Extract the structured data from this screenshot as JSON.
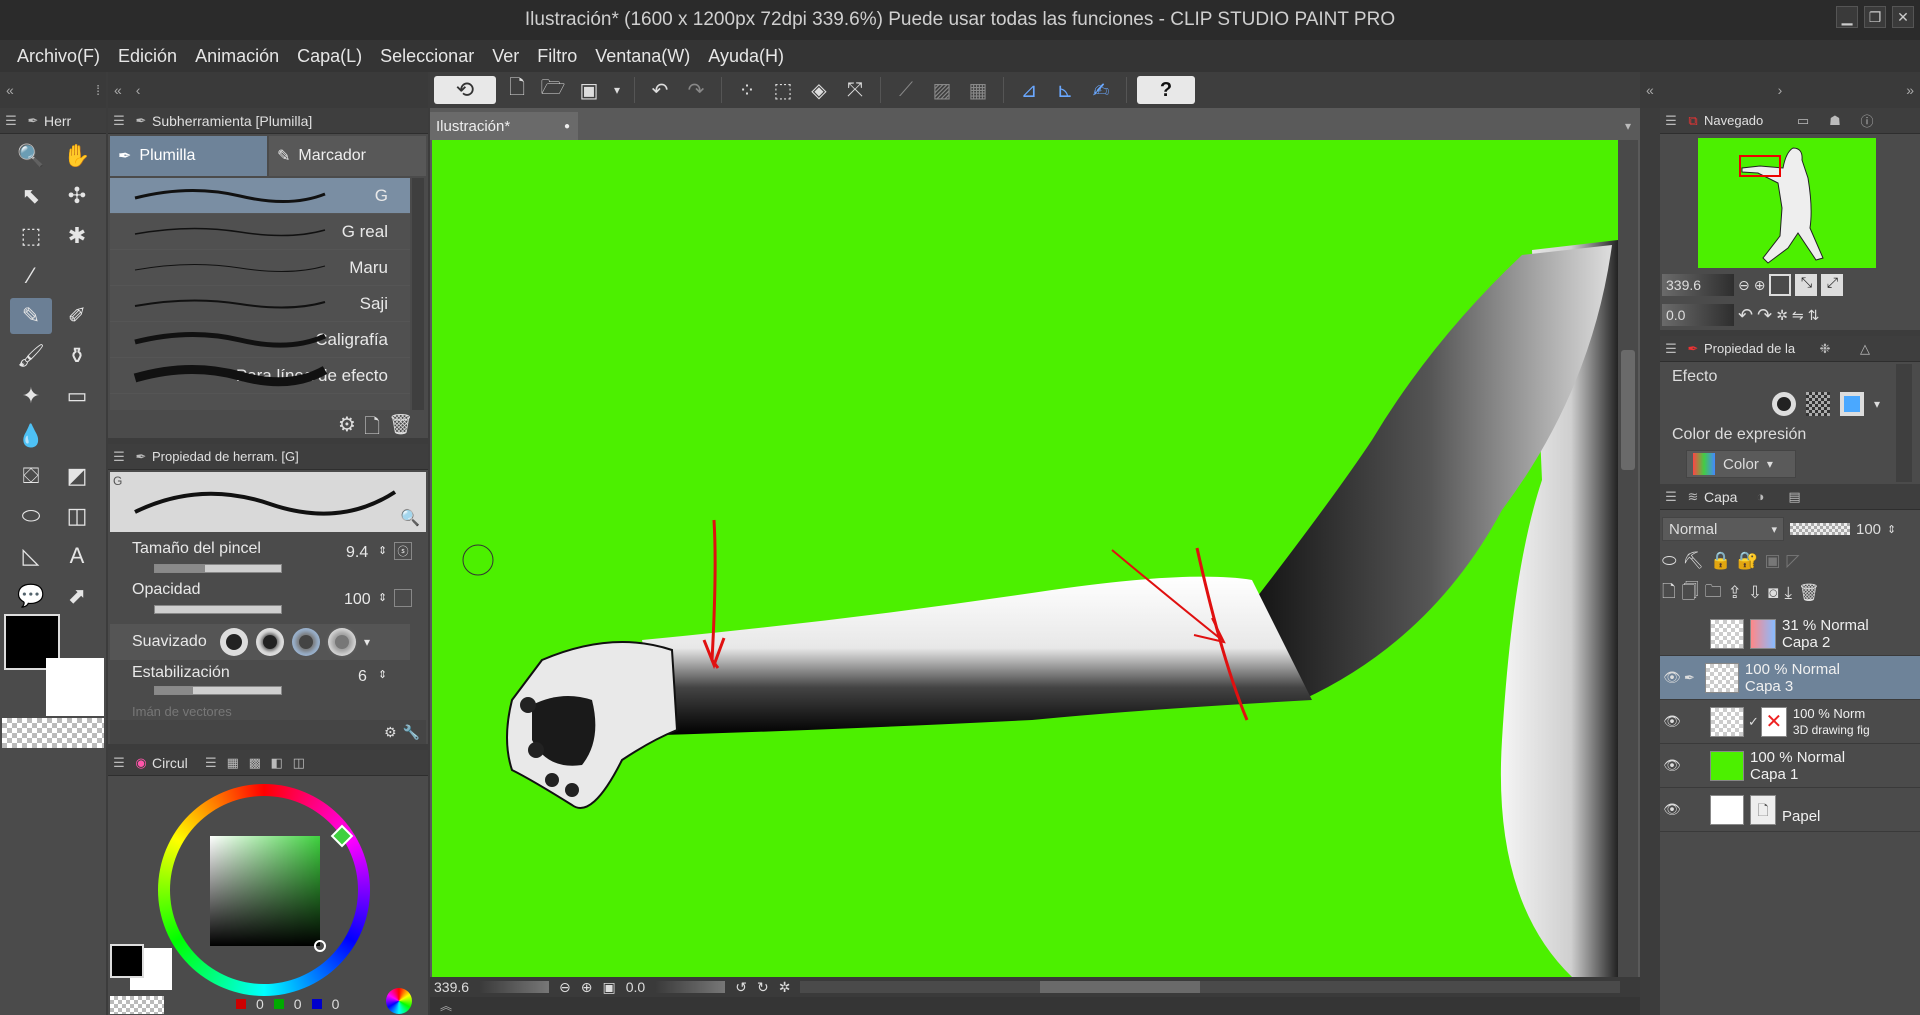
{
  "window": {
    "title": "Ilustración* (1600 x 1200px 72dpi 339.6%)  Puede usar todas las funciones - CLIP STUDIO PAINT PRO",
    "controls": [
      "minimize-icon",
      "maximize-icon",
      "close-icon"
    ]
  },
  "menu": [
    "Archivo(F)",
    "Edición",
    "Animación",
    "Capa(L)",
    "Seleccionar",
    "Ver",
    "Filtro",
    "Ventana(W)",
    "Ayuda(H)"
  ],
  "tool_panel": {
    "title": "Herr"
  },
  "subtool": {
    "title": "Subherramienta [Plumilla]",
    "tabs": [
      "Plumilla",
      "Marcador"
    ],
    "brushes": [
      "G",
      "G real",
      "Maru",
      "Saji",
      "Caligrafía",
      "Para línea de efecto"
    ]
  },
  "tool_property": {
    "title": "Propiedad de herram. [G]",
    "preview_label": "G",
    "brush_size_label": "Tamaño del pincel",
    "brush_size_value": "9.4",
    "opacity_label": "Opacidad",
    "opacity_value": "100",
    "smoothing_label": "Suavizado",
    "stabilization_label": "Estabilización",
    "stabilization_value": "6",
    "hidden_row": "Imán de vectores"
  },
  "color_panel": {
    "title": "Circul",
    "rgb": [
      "0",
      "0",
      "0"
    ],
    "main_color": "#000000",
    "sub_color": "#ffffff",
    "square_hue_color": "#3fd13f"
  },
  "document": {
    "tab_label": "Ilustración*",
    "zoom": "339.6",
    "rotation": "0.0",
    "background_color": "#4cf000"
  },
  "navigator": {
    "title": "Navegado",
    "zoom": "339.6",
    "rotation": "0.0"
  },
  "tool_prop2": {
    "title": "Propiedad de la",
    "effect_label": "Efecto",
    "expression_color_label": "Color de expresión",
    "expression_color_value": "Color"
  },
  "layers": {
    "title": "Capa",
    "blend_mode": "Normal",
    "opacity": "100",
    "rows": [
      {
        "opacity": "31 % Normal",
        "name": "Capa 2",
        "visible": false,
        "selected": false
      },
      {
        "opacity": "100 % Normal",
        "name": "Capa 3",
        "visible": true,
        "selected": true
      },
      {
        "opacity": "100 % Norm",
        "name": "3D drawing fig",
        "visible": true,
        "selected": false
      },
      {
        "opacity": "100 % Normal",
        "name": "Capa 1",
        "visible": true,
        "selected": false
      },
      {
        "opacity": "",
        "name": "Papel",
        "visible": true,
        "selected": false
      }
    ]
  }
}
